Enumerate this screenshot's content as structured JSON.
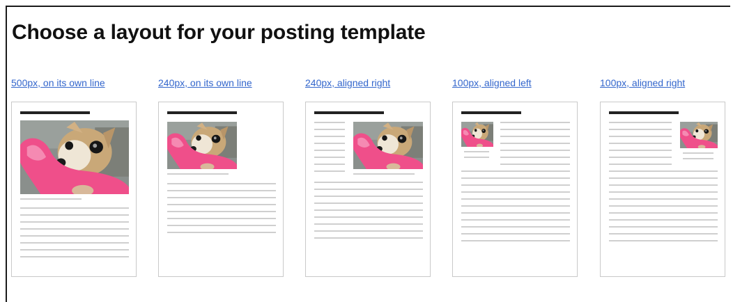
{
  "page": {
    "heading": "Choose a layout for your posting template"
  },
  "layouts": [
    {
      "label": "500px, on its own line"
    },
    {
      "label": "240px, on its own line"
    },
    {
      "label": "240px, aligned right"
    },
    {
      "label": "100px, aligned left"
    },
    {
      "label": "100px, aligned right"
    }
  ],
  "colors": {
    "link": "#3366cc",
    "title_bar": "#222222",
    "placeholder_line": "#cfcfcf",
    "card_border": "#c9c9c9"
  },
  "thumbnail": {
    "icon": "dog-photo-icon"
  }
}
